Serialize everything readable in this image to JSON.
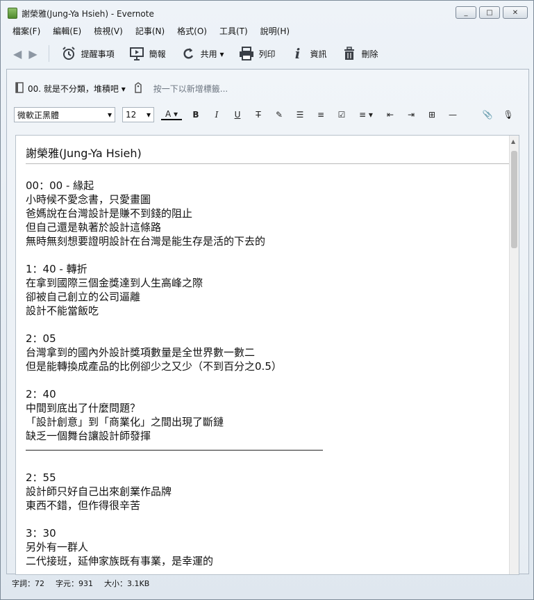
{
  "window": {
    "title": "謝榮雅(Jung-Ya Hsieh) - Evernote",
    "buttons": [
      "_",
      "□",
      "✕"
    ]
  },
  "menu": [
    "檔案(F)",
    "編輯(E)",
    "檢視(V)",
    "記事(N)",
    "格式(O)",
    "工具(T)",
    "說明(H)"
  ],
  "toolbar": {
    "back": "◀",
    "forward": "▶",
    "reminder": "提醒事項",
    "presentation": "簡報",
    "share": "共用 ▾",
    "print": "列印",
    "info": "資訊",
    "delete": "刪除"
  },
  "notebook": {
    "name": "00. 就是不分類，堆積吧 ▾",
    "tag_placeholder": "按一下以新增標籤..."
  },
  "format": {
    "font": "微軟正黑體",
    "size": "12",
    "font_color": "A"
  },
  "note": {
    "title": "謝榮雅(Jung-Ya Hsieh)",
    "lines": [
      "00：00 - 緣起",
      "小時候不愛念書，只愛畫圖",
      "爸媽說在台灣設計是賺不到錢的阻止",
      "但自己還是執著於設計這條路",
      "無時無刻想要證明設計在台灣是能生存是活的下去的",
      "",
      "1：40 - 轉折",
      "在拿到國際三個金獎達到人生高峰之際",
      "卻被自己創立的公司逼離",
      "設計不能當飯吃",
      "",
      "2：05",
      "台灣拿到的國內外設計獎項數量是全世界數一數二",
      "但是能轉換成產品的比例卻少之又少（不到百分之0.5）",
      "",
      "2：40",
      "中間到底出了什麼問題？",
      "「設計創意」到「商業化」之間出現了斷鏈",
      "缺乏一個舞台讓設計師發揮"
    ],
    "lines_after_rule": [
      "",
      "2：55",
      "設計師只好自己出來創業作品牌",
      "東西不錯，但作得很辛苦",
      "",
      "3：30",
      "另外有一群人",
      "二代接班，延伸家族既有事業，是幸運的"
    ]
  },
  "status": {
    "words": "字詞：72",
    "chars": "字元：931",
    "size": "大小：3.1KB"
  }
}
